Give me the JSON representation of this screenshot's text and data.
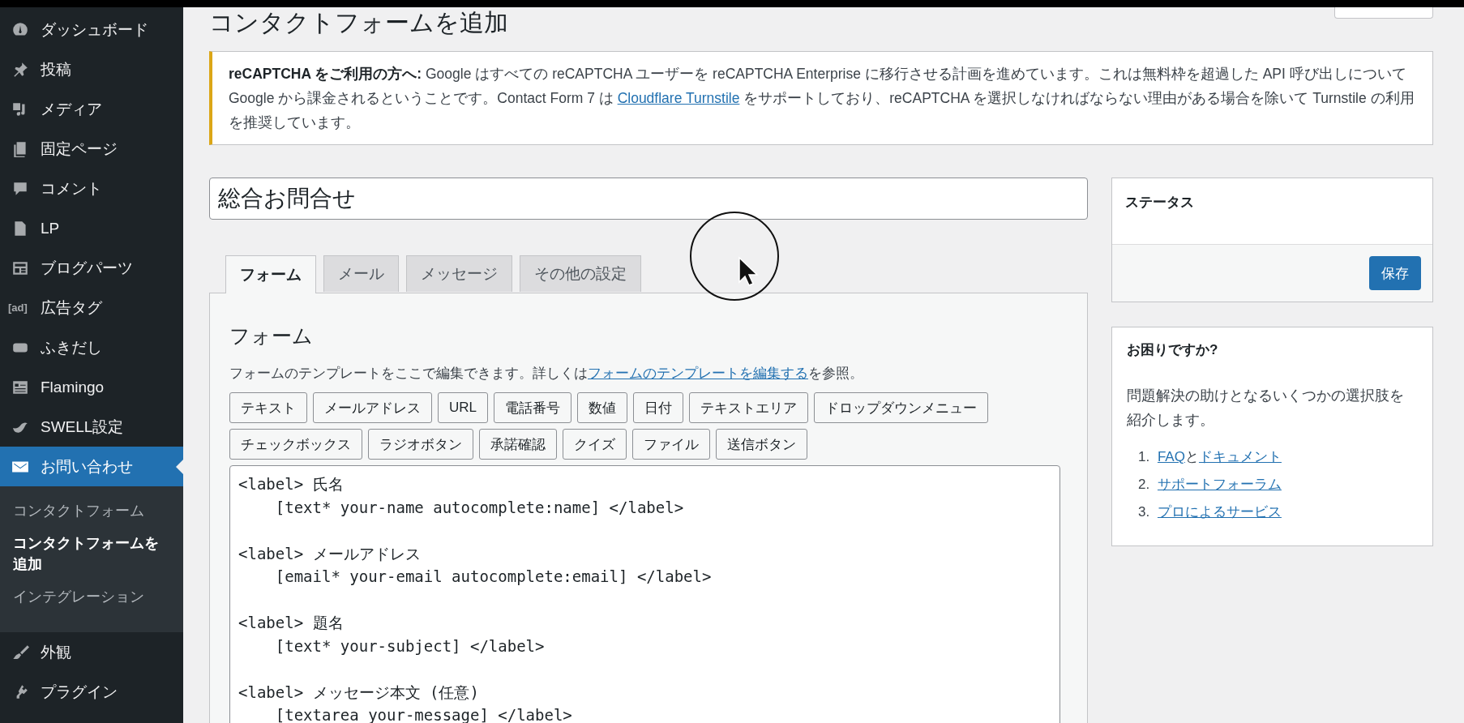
{
  "sidebar": {
    "items": [
      {
        "label": "ダッシュボード",
        "selected": false
      },
      {
        "label": "投稿",
        "selected": false
      },
      {
        "label": "メディア",
        "selected": false
      },
      {
        "label": "固定ページ",
        "selected": false
      },
      {
        "label": "コメント",
        "selected": false
      },
      {
        "label": "LP",
        "selected": false
      },
      {
        "label": "ブログパーツ",
        "selected": false
      },
      {
        "label": "広告タグ",
        "icon_text": "[ad]",
        "selected": false
      },
      {
        "label": "ふきだし",
        "selected": false
      },
      {
        "label": "Flamingo",
        "selected": false
      },
      {
        "label": "SWELL設定",
        "selected": false
      },
      {
        "label": "お問い合わせ",
        "selected": true,
        "children": [
          {
            "label": "コンタクトフォーム",
            "selected": false
          },
          {
            "label": "コンタクトフォームを追加",
            "selected": true
          },
          {
            "label": "インテグレーション",
            "selected": false
          }
        ]
      },
      {
        "label": "外観",
        "selected": false
      },
      {
        "label": "プラグイン",
        "selected": false
      }
    ]
  },
  "page_title": "コンタクトフォームを追加",
  "notice": {
    "text_before": "**reCAPTCHA をご利用の方へ:** Google はすべての reCAPTCHA ユーザーを reCAPTCHA Enterprise に移行させる計画を進めています。これは無料枠を超過した API 呼び出しについて Google から課金されるということです。Contact Form 7 は ",
    "link": "Cloudflare Turnstile",
    "text_after": " をサポートしており、reCAPTCHA を選択しなければならない理由がある場合を除いて Turnstile の利用を推奨しています。"
  },
  "form_title": {
    "value": "総合お問合せ"
  },
  "tabs": [
    {
      "label": "フォーム",
      "selected": true
    },
    {
      "label": "メール",
      "selected": false
    },
    {
      "label": "メッセージ",
      "selected": false
    },
    {
      "label": "その他の設定",
      "selected": false
    }
  ],
  "panel": {
    "heading": "フォーム",
    "description_before": "フォームのテンプレートをここで編集できます。詳しくは",
    "description_link": "フォームのテンプレートを編集する",
    "description_after": "を参照。",
    "tag_buttons": [
      [
        "テキスト",
        "メールアドレス",
        "URL",
        "電話番号",
        "数値",
        "日付",
        "テキストエリア",
        "ドロップダウンメニュー"
      ],
      [
        "チェックボックス",
        "ラジオボタン",
        "承諾確認",
        "クイズ",
        "ファイル",
        "送信ボタン"
      ]
    ],
    "template": "<label> 氏名\n    [text* your-name autocomplete:name] </label>\n\n<label> メールアドレス\n    [email* your-email autocomplete:email] </label>\n\n<label> 題名\n    [text* your-subject] </label>\n\n<label> メッセージ本文 (任意)\n    [textarea your-message] </label>"
  },
  "status_box": {
    "title": "ステータス",
    "save_button": "保存"
  },
  "help_box": {
    "title": "お困りですか?",
    "description": "問題解決の助けとなるいくつかの選択肢を紹介します。",
    "items": [
      {
        "number": "1.",
        "parts": [
          {
            "text": "FAQ",
            "link": true
          },
          {
            "text": "と",
            "link": false
          },
          {
            "text": "ドキュメント",
            "link": true
          }
        ]
      },
      {
        "number": "2.",
        "parts": [
          {
            "text": "サポートフォーラム",
            "link": true
          }
        ]
      },
      {
        "number": "3.",
        "parts": [
          {
            "text": "プロによるサービス",
            "link": true
          }
        ]
      }
    ]
  }
}
